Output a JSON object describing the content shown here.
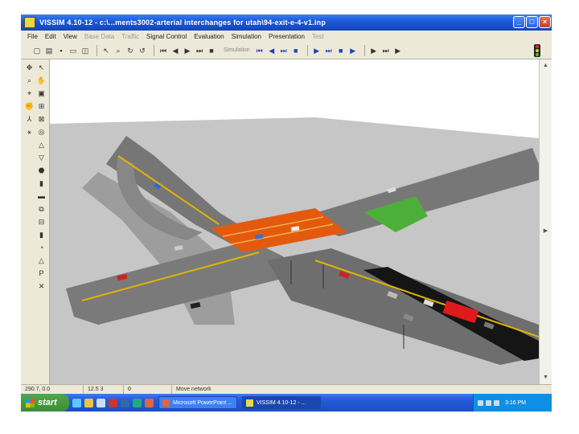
{
  "window": {
    "title": "VISSIM 4.10-12 - c:\\...ments3002-arterial interchanges for utah\\94-exit-e-4-v1.inp"
  },
  "menu": [
    {
      "label": "File",
      "enabled": true
    },
    {
      "label": "Edit",
      "enabled": true
    },
    {
      "label": "View",
      "enabled": true
    },
    {
      "label": "Base Data",
      "enabled": false
    },
    {
      "label": "Traffic",
      "enabled": false
    },
    {
      "label": "Signal Control",
      "enabled": true
    },
    {
      "label": "Evaluation",
      "enabled": true
    },
    {
      "label": "Simulation",
      "enabled": true
    },
    {
      "label": "Presentation",
      "enabled": true
    },
    {
      "label": "Test",
      "enabled": false
    }
  ],
  "toolbar": {
    "simulation_label": "Simulation"
  },
  "statusbar": {
    "coords": "290.7, 0.0",
    "field2": "12.5 3",
    "field3": "0",
    "mode": "Move network"
  },
  "taskbar": {
    "start_label": "start",
    "tasks": [
      {
        "label": "Microsoft PowerPoint ...",
        "active": false
      },
      {
        "label": "VISSIM 4.10-12 - ...",
        "active": true
      }
    ],
    "clock": "3:16 PM"
  },
  "colors": {
    "titlebar": "#245edb",
    "ground": "#c8c8c8",
    "road": "#7a7a7a",
    "median_stripe": "#e0b400",
    "bridge_deck": "#e35a0f",
    "grass": "#4caf3a"
  },
  "icons": {
    "close": "close-icon",
    "minimize": "minimize-icon",
    "maximize": "maximize-icon",
    "signal": "traffic-signal-icon"
  }
}
